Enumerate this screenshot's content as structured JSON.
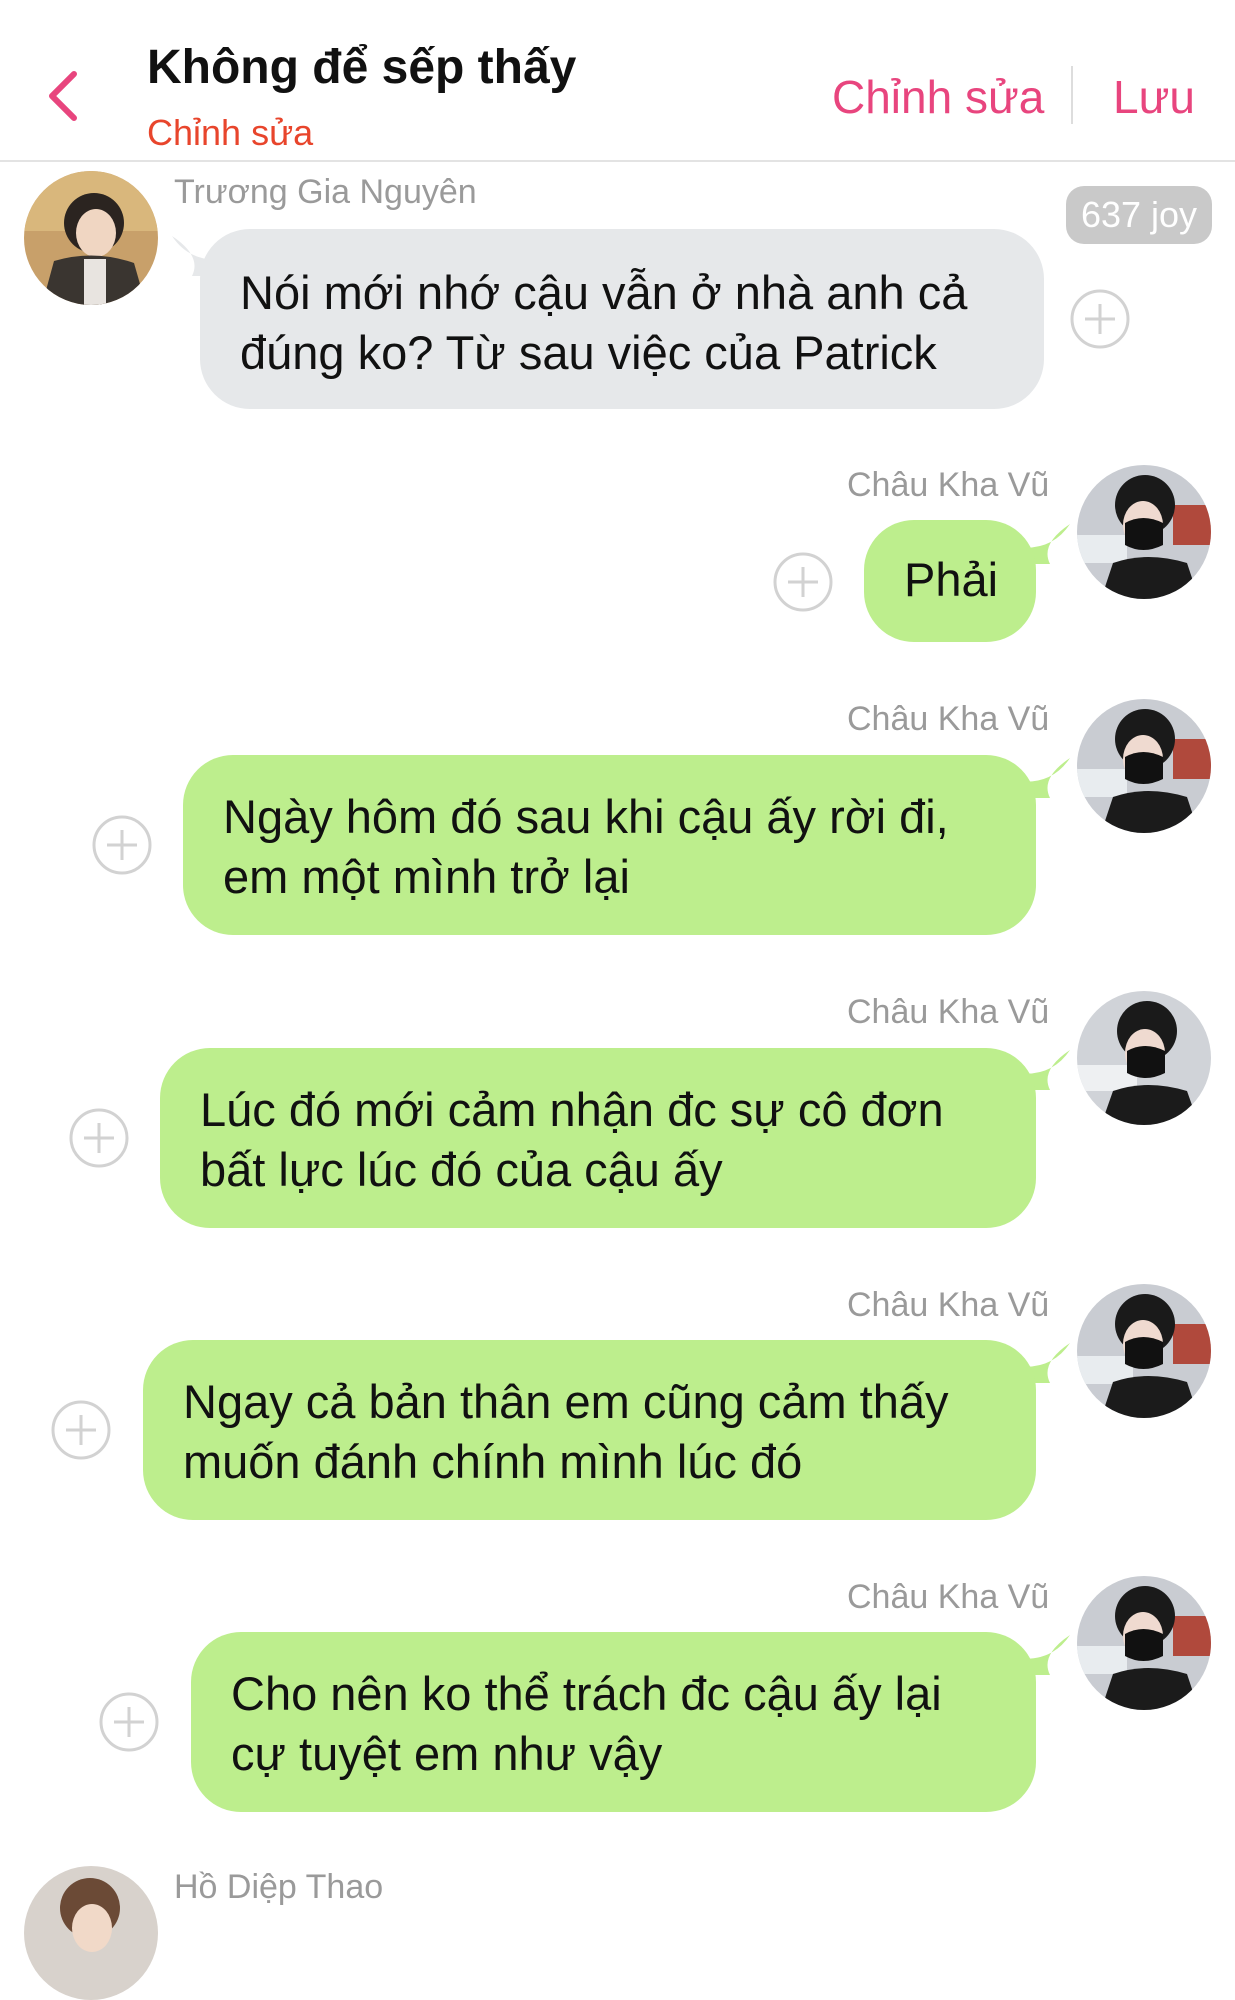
{
  "header": {
    "title": "Không để sếp thấy",
    "subtitle": "Chỉnh sửa",
    "edit_label": "Chỉnh sửa",
    "save_label": "Lưu",
    "accent_color": "#e8457e",
    "subtitle_color": "#e8452c"
  },
  "joy_badge": "637 joy",
  "messages": [
    {
      "sender": "Trương Gia Nguyên",
      "side": "left",
      "bubble_color": "#e6e8ea",
      "lines": [
        "Nói mới nhớ cậu vẫn ở nhà anh cả",
        "đúng ko? Từ sau việc của Patrick"
      ]
    },
    {
      "sender": "Châu Kha Vũ",
      "side": "right",
      "bubble_color": "#bdee8d",
      "lines": [
        "Phải"
      ]
    },
    {
      "sender": "Châu Kha Vũ",
      "side": "right",
      "bubble_color": "#bdee8d",
      "lines": [
        "Ngày hôm đó sau khi cậu ấy rời đi,",
        "em một mình trở lại"
      ]
    },
    {
      "sender": "Châu Kha Vũ",
      "side": "right",
      "bubble_color": "#bdee8d",
      "lines": [
        "Lúc đó mới cảm nhận đc sự cô đơn",
        "bất lực lúc đó của cậu ấy"
      ]
    },
    {
      "sender": "Châu Kha Vũ",
      "side": "right",
      "bubble_color": "#bdee8d",
      "lines": [
        "Ngay cả bản thân em cũng cảm thấy",
        "muốn đánh chính mình lúc đó"
      ]
    },
    {
      "sender": "Châu Kha Vũ",
      "side": "right",
      "bubble_color": "#bdee8d",
      "lines": [
        "Cho nên ko thể trách đc cậu ấy lại",
        "cự tuyệt em như vậy"
      ]
    },
    {
      "sender": "Hồ Diệp Thao",
      "side": "left",
      "bubble_color": "#e6e8ea",
      "lines": []
    }
  ],
  "icons": {
    "back": "chevron-left-icon",
    "add": "plus-circle-icon"
  }
}
